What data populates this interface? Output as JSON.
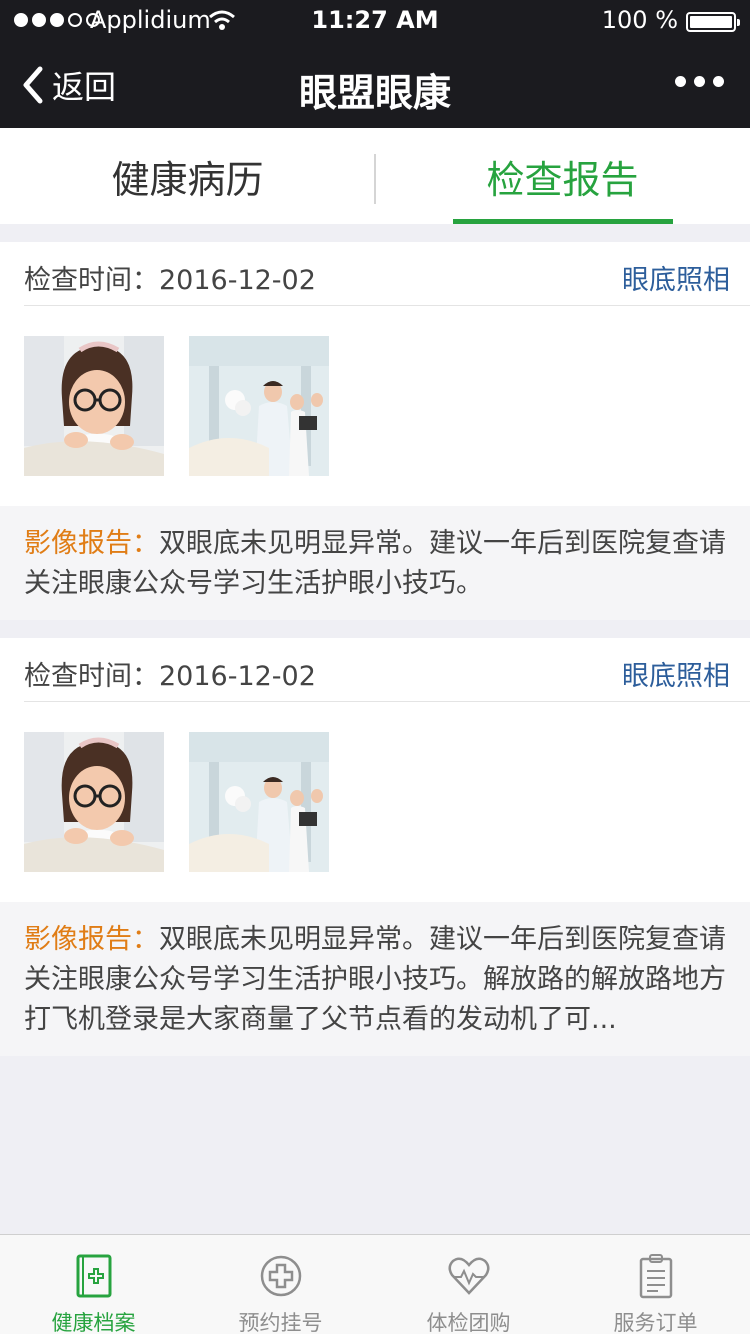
{
  "status_bar": {
    "carrier": "Applidium",
    "time": "11:27 AM",
    "battery": "100 %"
  },
  "nav": {
    "back_label": "返回",
    "title": "眼盟眼康"
  },
  "tabs": [
    {
      "label": "健康病历",
      "active": false
    },
    {
      "label": "检查报告",
      "active": true
    }
  ],
  "records": [
    {
      "date_label": "检查时间：2016-12-02",
      "exam_type": "眼底照相",
      "report_label": "影像报告：",
      "report_text": "双眼底未见明显异常。建议一年后到医院复查请关注眼康公众号学习生活护眼小技巧。"
    },
    {
      "date_label": "检查时间：2016-12-02",
      "exam_type": "眼底照相",
      "report_label": "影像报告：",
      "report_text": "双眼底未见明显异常。建议一年后到医院复查请关注眼康公众号学习生活护眼小技巧。解放路的解放路地方打飞机登录是大家商量了父节点看的发动机了可..."
    }
  ],
  "tabbar": [
    {
      "label": "健康档案",
      "icon": "health-record-icon",
      "active": true
    },
    {
      "label": "预约挂号",
      "icon": "medical-cross-icon",
      "active": false
    },
    {
      "label": "体检团购",
      "icon": "heart-pulse-icon",
      "active": false
    },
    {
      "label": "服务订单",
      "icon": "clipboard-icon",
      "active": false
    }
  ],
  "colors": {
    "accent": "#27a33f",
    "link": "#2d5e9b",
    "report_label": "#e07d16",
    "nav_bg": "#1b1b1f"
  }
}
